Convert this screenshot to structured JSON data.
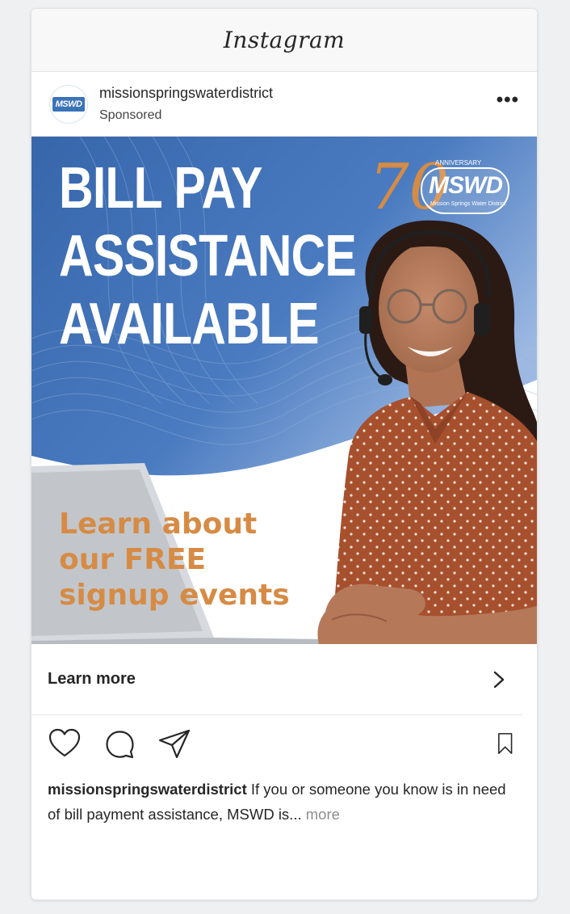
{
  "app": {
    "title": "Instagram"
  },
  "post": {
    "username": "missionspringswaterdistrict",
    "sponsored_label": "Sponsored",
    "avatar_text": "MSWD",
    "more_icon": "more-horizontal-icon"
  },
  "ad": {
    "headline": [
      "BILL PAY",
      "ASSISTANCE",
      "AVAILABLE"
    ],
    "promo": [
      "Learn about",
      "our FREE",
      "signup events"
    ],
    "logo": {
      "number": "70",
      "anniversary": "ANNIVERSARY",
      "name": "MSWD",
      "subtitle": "Mission Springs Water District"
    },
    "colors": {
      "blue": "#3f6fb0",
      "light_blue": "#7fa3d6",
      "orange": "#d68b45",
      "blouse": "#a7502e"
    }
  },
  "cta": {
    "label": "Learn more",
    "icon": "chevron-right-icon"
  },
  "actions": {
    "icons": [
      "heart-icon",
      "comment-icon",
      "share-icon",
      "bookmark-icon"
    ]
  },
  "caption": {
    "user": "missionspringswaterdistrict",
    "text": " If you or someone you know is in need of bill payment assistance, MSWD is... ",
    "more": "more"
  }
}
